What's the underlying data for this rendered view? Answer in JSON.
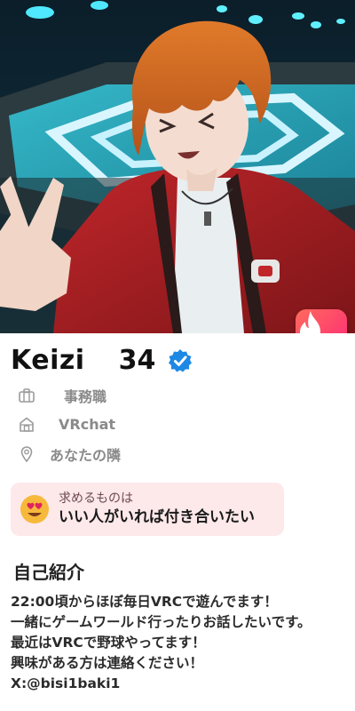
{
  "profile": {
    "name": "Keizi",
    "age": "34",
    "verified": true,
    "details": [
      {
        "icon": "briefcase-icon",
        "text": "事務職"
      },
      {
        "icon": "home-icon",
        "text": "VRchat"
      },
      {
        "icon": "location-pin-icon",
        "text": "あなたの隣"
      }
    ],
    "looking_for": {
      "icon": "heart-eyes-emoji-icon",
      "label": "求めるものは",
      "value": "いい人がいれば付き合いたい"
    },
    "about_title": "自己紹介",
    "bio_lines": [
      "22:00頃からほぼ毎日VRCで遊んでます！",
      "一緒にゲームワールド行ったりお話したいです。",
      "最近はVRCで野球やってます！",
      "興味がある方は連絡ください！",
      "X:@bisi1baki1"
    ]
  },
  "colors": {
    "brand_gradient_start": "#ff6a5c",
    "brand_gradient_end": "#fd267a",
    "verified_blue": "#1e88e5",
    "looking_card_bg": "#fde8ea"
  },
  "icons": {
    "brand": "flame-logo-icon",
    "verified": "verified-check-icon"
  }
}
